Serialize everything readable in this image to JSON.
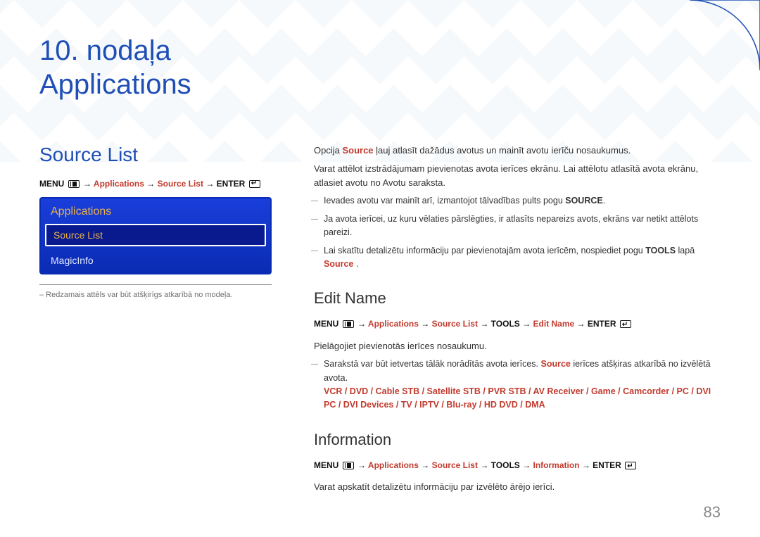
{
  "chapter": {
    "number_label": "10. nodaļa",
    "title": "Applications"
  },
  "left": {
    "section_title": "Source List",
    "menu_path": {
      "menu_label": "MENU",
      "arrow": "→",
      "applications": "Applications",
      "source_list": "Source List",
      "enter_label": "ENTER"
    },
    "tv": {
      "header": "Applications",
      "item_active": "Source List",
      "item_other": "MagicInfo"
    },
    "footnote": "– Redzamais attēls var būt atšķirīgs atkarībā no modeļa."
  },
  "right": {
    "intro_1a": "Opcija ",
    "intro_1b": "Source",
    "intro_1c": " ļauj atlasīt dažādus avotus un mainīt avotu ierīču nosaukumus.",
    "intro_2": "Varat attēlot izstrādājumam pievienotas avota ierīces ekrānu. Lai attēlotu atlasītā avota ekrānu, atlasiet avotu no Avotu saraksta.",
    "dash_items": {
      "d1a": "Ievades avotu var mainīt arī, izmantojot tālvadības pults pogu ",
      "d1b": "SOURCE",
      "d1c": ".",
      "d2": "Ja avota ierīcei, uz kuru vēlaties pārslēgties, ir atlasīts nepareizs avots, ekrāns var netikt attēlots pareizi.",
      "d3a": "Lai skatītu detalizētu informāciju par pievienotajām avota ierīcēm, nospiediet pogu ",
      "d3b": "TOOLS",
      "d3c": " lapā ",
      "d3d": "Source",
      "d3e": " ."
    },
    "edit_name": {
      "heading": "Edit Name",
      "path": {
        "menu_label": "MENU",
        "applications": "Applications",
        "source_list": "Source List",
        "tools": "TOOLS",
        "edit_name": "Edit Name",
        "enter_label": "ENTER",
        "arrow": "→"
      },
      "line1": "Pielāgojiet pievienotās ierīces nosaukumu.",
      "line2a": "Sarakstā var būt ietvertas tālāk norādītās avota ierīces. ",
      "line2b": "Source",
      "line2c": " ierīces atšķiras atkarībā no izvēlētā avota.",
      "devices": "VCR / DVD / Cable STB / Satellite STB / PVR STB / AV Receiver / Game / Camcorder / PC / DVI PC / DVI Devices / TV / IPTV / Blu-ray / HD DVD / DMA"
    },
    "information": {
      "heading": "Information",
      "path": {
        "menu_label": "MENU",
        "applications": "Applications",
        "source_list": "Source List",
        "tools": "TOOLS",
        "information": "Information",
        "enter_label": "ENTER",
        "arrow": "→"
      },
      "line": "Varat apskatīt detalizētu informāciju par izvēlēto ārējo ierīci."
    }
  },
  "page_number": "83"
}
